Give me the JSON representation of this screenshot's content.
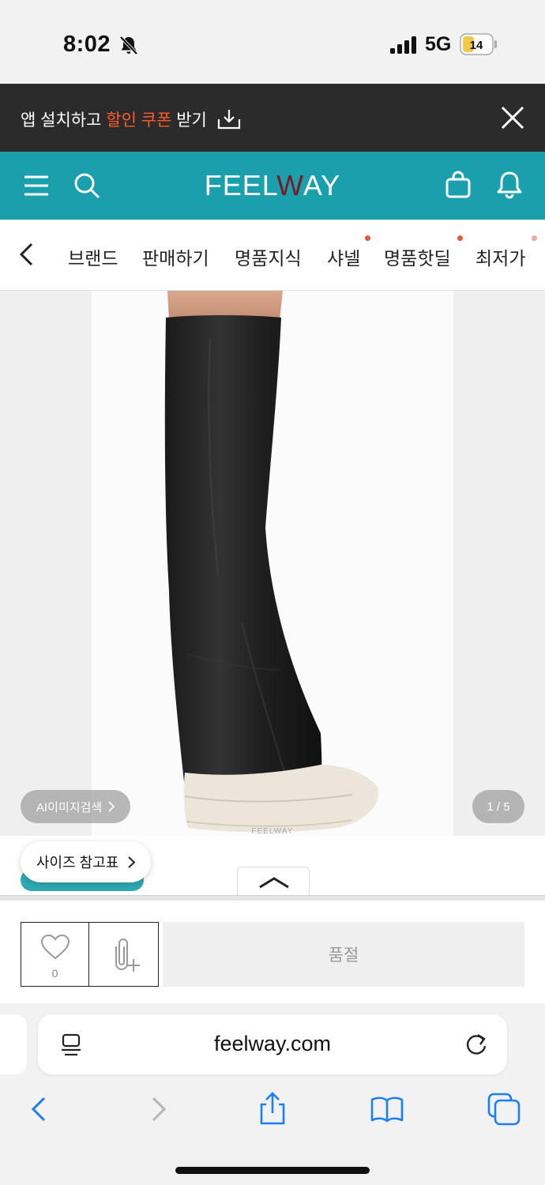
{
  "status_bar": {
    "time": "8:02",
    "network": "5G",
    "battery": "14"
  },
  "app_banner": {
    "text_before": "앱 설치하고 ",
    "highlight": "할인 쿠폰",
    "text_after": " 받기"
  },
  "header": {
    "logo_pre": "FEEL",
    "logo_w": "W",
    "logo_post": "AY"
  },
  "categories": [
    {
      "label": "브랜드",
      "dot": false
    },
    {
      "label": "판매하기",
      "dot": false
    },
    {
      "label": "명품지식",
      "dot": false
    },
    {
      "label": "샤넬",
      "dot": true
    },
    {
      "label": "명품핫딜",
      "dot": true
    },
    {
      "label": "최저가",
      "dot": true
    }
  ],
  "product": {
    "watermark": "FEELWAY",
    "ai_search_label": "AI이미지검색",
    "pager": "1 / 5",
    "size_chart_label": "사이즈 참고표"
  },
  "action_bar": {
    "like_count": "0",
    "soldout_label": "품절"
  },
  "browser": {
    "url": "feelway.com"
  },
  "colors": {
    "accent": "#1a9fad",
    "highlight": "#ff5a2b",
    "logo_w": "#7a1b24",
    "ios_blue": "#1a7ef5"
  }
}
